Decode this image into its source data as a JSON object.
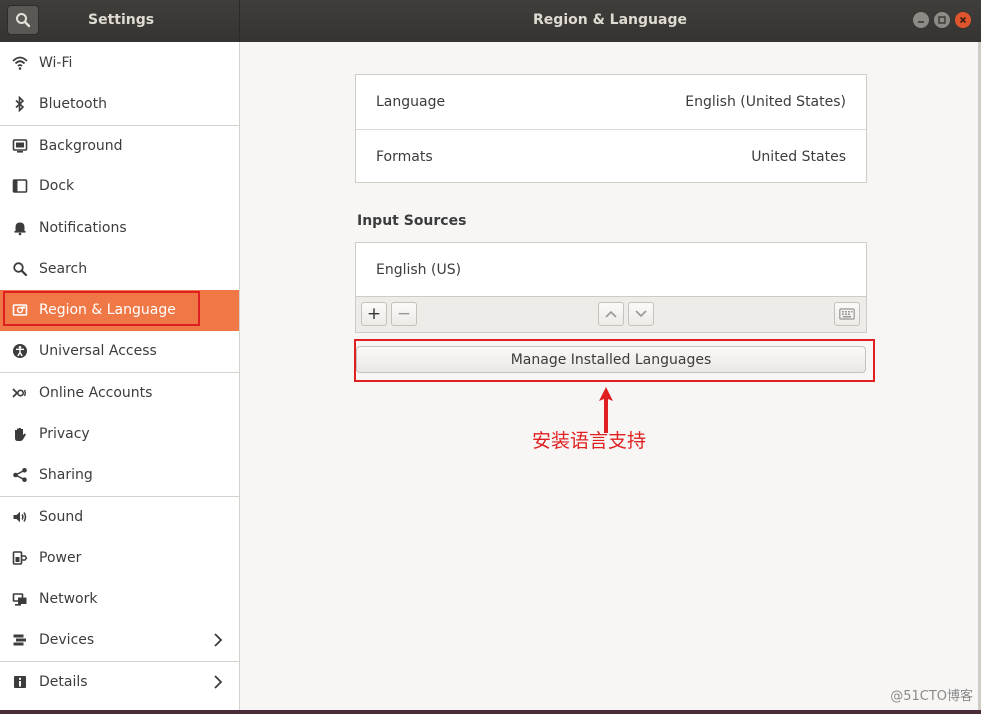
{
  "window": {
    "sidebar_title": "Settings",
    "panel_title": "Region & Language"
  },
  "sidebar": {
    "items": [
      {
        "label": "Wi-Fi",
        "icon": "wifi-icon"
      },
      {
        "label": "Bluetooth",
        "icon": "bluetooth-icon"
      },
      {
        "label": "Background",
        "icon": "background-icon"
      },
      {
        "label": "Dock",
        "icon": "dock-icon"
      },
      {
        "label": "Notifications",
        "icon": "bell-icon"
      },
      {
        "label": "Search",
        "icon": "search-icon"
      },
      {
        "label": "Region & Language",
        "icon": "region-icon",
        "active": true
      },
      {
        "label": "Universal Access",
        "icon": "accessibility-icon"
      },
      {
        "label": "Online Accounts",
        "icon": "online-accounts-icon"
      },
      {
        "label": "Privacy",
        "icon": "hand-icon"
      },
      {
        "label": "Sharing",
        "icon": "share-icon"
      },
      {
        "label": "Sound",
        "icon": "speaker-icon"
      },
      {
        "label": "Power",
        "icon": "power-icon"
      },
      {
        "label": "Network",
        "icon": "network-icon"
      },
      {
        "label": "Devices",
        "icon": "devices-icon",
        "has_chevron": true
      },
      {
        "label": "Details",
        "icon": "details-icon",
        "has_chevron": true
      }
    ]
  },
  "language_section": {
    "rows": [
      {
        "label": "Language",
        "value": "English (United States)"
      },
      {
        "label": "Formats",
        "value": "United States"
      }
    ]
  },
  "input_sources": {
    "heading": "Input Sources",
    "items": [
      "English (US)"
    ],
    "add_label": "+",
    "remove_label": "−"
  },
  "manage_button": {
    "label": "Manage Installed Languages"
  },
  "annotation": {
    "text": "安装语言支持"
  },
  "watermark": {
    "text": "@51CTO博客"
  },
  "colors": {
    "accent": "#f07746",
    "highlight": "#e02020"
  }
}
